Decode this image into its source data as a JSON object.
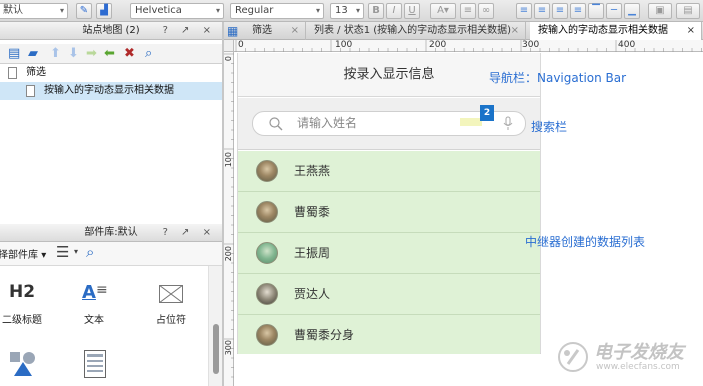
{
  "toolbar": {
    "left_field": "默认",
    "font_family": "Helvetica",
    "font_style": "Regular",
    "font_size": "13"
  },
  "sitemap": {
    "title": "站点地图 (2)",
    "controls": "? ↗ ×",
    "items": [
      {
        "label": "筛选"
      },
      {
        "label": "按输入的字动态显示相关数据"
      }
    ]
  },
  "library": {
    "title": "部件库:默认",
    "controls": "? ↗ ×",
    "selector_label": "择部件库",
    "items": [
      {
        "icon_text": "H2",
        "label": "二级标题"
      },
      {
        "icon_text": "A",
        "label": "文本"
      },
      {
        "icon_text": "",
        "label": "占位符"
      }
    ]
  },
  "tabs": [
    {
      "label": "筛选"
    },
    {
      "label": "列表 / 状态1 (按输入的字动态显示相关数据)"
    },
    {
      "label": "按输入的字动态显示相关数据"
    }
  ],
  "ruler": {
    "h_marks": [
      "0",
      "100",
      "200",
      "300",
      "400"
    ],
    "v_marks": [
      "0",
      "100",
      "200",
      "300"
    ]
  },
  "screen": {
    "nav_title": "按录入显示信息",
    "search_placeholder": "请输入姓名",
    "badge": "2",
    "list": [
      {
        "name": "王燕燕"
      },
      {
        "name": "曹蜀黍"
      },
      {
        "name": "王振周"
      },
      {
        "name": "贾达人"
      },
      {
        "name": "曹蜀黍分身"
      }
    ]
  },
  "notes": {
    "navbar": "导航栏：Navigation Bar",
    "searchbar": "搜索栏",
    "repeater": "中继器创建的数据列表"
  },
  "watermark": {
    "text": "电子发烧友",
    "url": "www.elecfans.com"
  },
  "colors": {
    "accent": "#2a6ed2",
    "list_bg": "#dff2d6",
    "badge": "#1a73c9"
  }
}
